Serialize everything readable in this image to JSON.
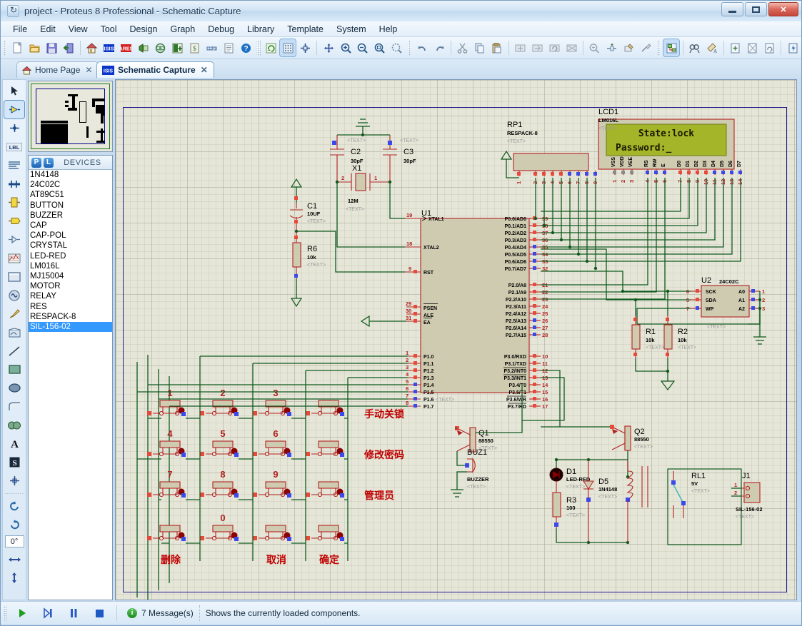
{
  "window": {
    "title": "project - Proteus 8 Professional - Schematic Capture",
    "minimize_label": "",
    "maximize_label": "",
    "close_label": "✕"
  },
  "menubar": {
    "items": [
      "File",
      "Edit",
      "View",
      "Tool",
      "Design",
      "Graph",
      "Debug",
      "Library",
      "Template",
      "System",
      "Help"
    ]
  },
  "tabs": [
    {
      "label": "Home Page",
      "icon": "home-icon",
      "close": "✕",
      "active": false
    },
    {
      "label": "Schematic Capture",
      "icon": "isis-icon",
      "close": "✕",
      "active": true
    }
  ],
  "toolbar": {
    "groups": [
      {
        "buttons": [
          {
            "name": "new-design-button",
            "tip": "New Project"
          },
          {
            "name": "open-design-button",
            "tip": "Open Project"
          },
          {
            "name": "save-design-button",
            "tip": "Save Project"
          },
          {
            "name": "import-export-button",
            "tip": "Import/Export"
          },
          {
            "name": "home-page-button",
            "tip": "Home Page"
          },
          {
            "name": "schematic-capture-button",
            "tip": "Schematic Capture"
          },
          {
            "name": "pcb-layout-button",
            "tip": "PCB Layout"
          },
          {
            "name": "source-code-button",
            "tip": "Source Code"
          },
          {
            "name": "3d-visualizer-button",
            "tip": "3D Visualizer"
          },
          {
            "name": "bill-of-materials-button",
            "tip": "Bill of Materials"
          },
          {
            "name": "design-explorer-button",
            "tip": "Design Explorer"
          },
          {
            "name": "project-clips-button",
            "tip": "Project Clips"
          },
          {
            "name": "report-button",
            "tip": "Report"
          },
          {
            "name": "help-button",
            "tip": "Help"
          }
        ]
      },
      {
        "buttons": [
          {
            "name": "refresh-button",
            "tip": "Redraw"
          },
          {
            "name": "toggle-grid-button",
            "tip": "Toggle Grid"
          },
          {
            "name": "origin-button",
            "tip": "Set Origin"
          },
          {
            "name": "pan-button",
            "tip": "Pan"
          },
          {
            "name": "zoom-in-button",
            "tip": "Zoom In"
          },
          {
            "name": "zoom-out-button",
            "tip": "Zoom Out"
          },
          {
            "name": "zoom-all-button",
            "tip": "Zoom to View Entire Sheet"
          },
          {
            "name": "zoom-area-button",
            "tip": "Zoom to Area"
          }
        ]
      },
      {
        "buttons": [
          {
            "name": "undo-button",
            "tip": "Undo"
          },
          {
            "name": "redo-button",
            "tip": "Redo"
          },
          {
            "name": "cut-button",
            "tip": "Cut to Clipboard"
          },
          {
            "name": "copy-button",
            "tip": "Copy to Clipboard"
          },
          {
            "name": "paste-button",
            "tip": "Paste from Clipboard"
          },
          {
            "name": "block-copy-button",
            "tip": "Block Copy"
          },
          {
            "name": "block-move-button",
            "tip": "Block Move"
          },
          {
            "name": "block-rotate-button",
            "tip": "Block Rotate"
          },
          {
            "name": "block-delete-button",
            "tip": "Block Delete"
          },
          {
            "name": "pick-device-button",
            "tip": "Pick Device"
          },
          {
            "name": "make-device-button",
            "tip": "Make Device"
          },
          {
            "name": "packaging-tool-button",
            "tip": "Packaging Tool"
          },
          {
            "name": "decompose-button",
            "tip": "Decompose"
          }
        ]
      },
      {
        "buttons": [
          {
            "name": "wire-autorouter-button",
            "tip": "Wire Auto-Router",
            "pressed": true
          },
          {
            "name": "search-tag-button",
            "tip": "Search and Tag"
          },
          {
            "name": "property-assignment-button",
            "tip": "Property Assignment Tool"
          },
          {
            "name": "new-sheet-button",
            "tip": "New Sheet"
          },
          {
            "name": "remove-sheet-button",
            "tip": "Remove/Delete Sheet"
          },
          {
            "name": "exit-sheet-button",
            "tip": "Exit to parent sheet"
          },
          {
            "name": "bill-materials-button",
            "tip": "Bill of Materials"
          }
        ]
      }
    ]
  },
  "left_tools": [
    {
      "name": "selection-mode-tool",
      "icon": "arrow-icon",
      "active": false
    },
    {
      "name": "component-mode-tool",
      "icon": "component-icon",
      "active": true
    },
    {
      "name": "junction-dot-tool",
      "icon": "junction-icon",
      "active": false
    },
    {
      "name": "wire-label-tool",
      "icon": "label-icon",
      "active": false
    },
    {
      "name": "text-script-tool",
      "icon": "script-icon",
      "active": false
    },
    {
      "name": "buses-tool",
      "icon": "bus-icon",
      "active": false
    },
    {
      "name": "subcircuit-tool",
      "icon": "subcircuit-icon",
      "active": false
    },
    {
      "name": "terminals-tool",
      "icon": "terminal-icon",
      "active": false
    },
    {
      "name": "device-pins-tool",
      "icon": "devicepin-icon",
      "active": false
    },
    {
      "name": "graph-tool",
      "icon": "graph-icon",
      "active": false
    },
    {
      "name": "tape-recorder-tool",
      "icon": "tape-icon",
      "active": false
    },
    {
      "name": "generator-tool",
      "icon": "generator-icon",
      "active": false
    },
    {
      "name": "voltage-probe-tool",
      "icon": "probe-icon",
      "active": false
    },
    {
      "name": "virtual-instrument-tool",
      "icon": "instrument-icon",
      "active": false
    },
    {
      "name": "line-tool",
      "icon": "line-icon",
      "active": false
    },
    {
      "name": "box-tool",
      "icon": "box-icon",
      "active": false
    },
    {
      "name": "circle-tool",
      "icon": "circle-icon",
      "active": false
    },
    {
      "name": "arc-tool",
      "icon": "arc-icon",
      "active": false
    },
    {
      "name": "path-tool",
      "icon": "path-icon",
      "active": false
    },
    {
      "name": "text-tool",
      "icon": "text-a-icon",
      "active": false
    },
    {
      "name": "symbol-tool",
      "icon": "symbol-s-icon",
      "active": false
    },
    {
      "name": "marker-tool",
      "icon": "marker-icon",
      "active": false
    }
  ],
  "rotation": {
    "clockwise_name": "rotate-clockwise-button",
    "anticlockwise_name": "rotate-anticlockwise-button",
    "angle": "0°",
    "mirror_x_name": "mirror-horizontal-button",
    "mirror_y_name": "mirror-vertical-button"
  },
  "devices_panel": {
    "pick_button": "P",
    "library_button": "L",
    "header": "DEVICES",
    "items": [
      "1N4148",
      "24C02C",
      "AT89C51",
      "BUTTON",
      "BUZZER",
      "CAP",
      "CAP-POL",
      "CRYSTAL",
      "LED-RED",
      "LM016L",
      "MJ15004",
      "MOTOR",
      "RELAY",
      "RES",
      "RESPACK-8",
      "SIL-156-02"
    ],
    "selected": "SIL-156-02"
  },
  "statusbar": {
    "play_button": "play-simulation-button",
    "step_button": "step-simulation-button",
    "pause_button": "pause-simulation-button",
    "stop_button": "stop-simulation-button",
    "messages": "7 Message(s)",
    "hint": "Shows the currently loaded components."
  },
  "schematic": {
    "lcd": {
      "ref": "LCD1",
      "value": "LM016L",
      "text": "<TEXT>",
      "line1": "State:lock",
      "line2": "Password:_",
      "pins": [
        "VSS",
        "VDD",
        "VEE",
        "RS",
        "RW",
        "E",
        "D0",
        "D1",
        "D2",
        "D3",
        "D4",
        "D5",
        "D6",
        "D7"
      ],
      "pin_numbers": [
        "1",
        "2",
        "3",
        "4",
        "5",
        "6",
        "7",
        "8",
        "9",
        "10",
        "11",
        "12",
        "13",
        "14"
      ]
    },
    "u1": {
      "ref": "U1",
      "text": "<TEXT>",
      "left_pins": [
        {
          "num": "19",
          "label": "XTAL1"
        },
        {
          "num": "18",
          "label": "XTAL2"
        },
        {
          "num": "9",
          "label": "RST"
        },
        {
          "num": "29",
          "label": "PSEN"
        },
        {
          "num": "30",
          "label": "ALE"
        },
        {
          "num": "31",
          "label": "EA"
        },
        {
          "num": "1",
          "label": "P1.0"
        },
        {
          "num": "2",
          "label": "P1.1"
        },
        {
          "num": "3",
          "label": "P1.2"
        },
        {
          "num": "4",
          "label": "P1.3"
        },
        {
          "num": "5",
          "label": "P1.4"
        },
        {
          "num": "6",
          "label": "P1.5"
        },
        {
          "num": "7",
          "label": "P1.6"
        },
        {
          "num": "8",
          "label": "P1.7"
        }
      ],
      "right_pins": [
        {
          "num": "39",
          "label": "P0.0/AD0"
        },
        {
          "num": "38",
          "label": "P0.1/AD1"
        },
        {
          "num": "37",
          "label": "P0.2/AD2"
        },
        {
          "num": "36",
          "label": "P0.3/AD3"
        },
        {
          "num": "35",
          "label": "P0.4/AD4"
        },
        {
          "num": "34",
          "label": "P0.5/AD5"
        },
        {
          "num": "33",
          "label": "P0.6/AD6"
        },
        {
          "num": "32",
          "label": "P0.7/AD7"
        },
        {
          "num": "21",
          "label": "P2.0/A8"
        },
        {
          "num": "22",
          "label": "P2.1/A9"
        },
        {
          "num": "23",
          "label": "P2.2/A10"
        },
        {
          "num": "24",
          "label": "P2.3/A11"
        },
        {
          "num": "25",
          "label": "P2.4/A12"
        },
        {
          "num": "26",
          "label": "P2.5/A13"
        },
        {
          "num": "27",
          "label": "P2.6/A14"
        },
        {
          "num": "28",
          "label": "P2.7/A15"
        },
        {
          "num": "10",
          "label": "P3.0/RXD"
        },
        {
          "num": "11",
          "label": "P3.1/TXD"
        },
        {
          "num": "12",
          "label": "P3.2/INT0"
        },
        {
          "num": "13",
          "label": "P3.3/INT1"
        },
        {
          "num": "14",
          "label": "P3.4/T0"
        },
        {
          "num": "15",
          "label": "P3.5/T1"
        },
        {
          "num": "16",
          "label": "P3.6/WR"
        },
        {
          "num": "17",
          "label": "P3.7/RD"
        }
      ]
    },
    "u2": {
      "ref": "U2",
      "value": "24C02C",
      "text": "<TEXT>",
      "left_pins": [
        {
          "num": "6",
          "label": "SCK"
        },
        {
          "num": "5",
          "label": "SDA"
        },
        {
          "num": "7",
          "label": "WP"
        }
      ],
      "right_pins": [
        {
          "num": "1",
          "label": "A0"
        },
        {
          "num": "2",
          "label": "A1"
        },
        {
          "num": "3",
          "label": "A2"
        }
      ]
    },
    "rp1": {
      "ref": "RP1",
      "value": "RESPACK-8",
      "text": "<TEXT>",
      "pins": [
        "1",
        "2",
        "3",
        "4",
        "5",
        "6",
        "7",
        "8",
        "9"
      ]
    },
    "components": [
      {
        "ref": "C1",
        "value": "10UF",
        "text": "<TEXT>"
      },
      {
        "ref": "C2",
        "value": "30pF",
        "text": "<TEXT>"
      },
      {
        "ref": "C3",
        "value": "30pF",
        "text": "<TEXT>"
      },
      {
        "ref": "X1",
        "value": "12M",
        "text": "<TEXT>"
      },
      {
        "ref": "R6",
        "value": "10k",
        "text": "<TEXT>"
      },
      {
        "ref": "R1",
        "value": "10k",
        "text": "<TEXT>"
      },
      {
        "ref": "R2",
        "value": "10k",
        "text": "<TEXT>"
      },
      {
        "ref": "R3",
        "value": "100",
        "text": "<TEXT>"
      },
      {
        "ref": "Q1",
        "value": "88550",
        "text": "<TEXT>"
      },
      {
        "ref": "Q2",
        "value": "88550",
        "text": "<TEXT>"
      },
      {
        "ref": "D1",
        "value": "LED-RED",
        "text": "<TEXT>"
      },
      {
        "ref": "D5",
        "value": "1N4148",
        "text": "<TEXT>"
      },
      {
        "ref": "BUZ1",
        "value": "BUZZER",
        "text": "<TEXT>"
      },
      {
        "ref": "RL1",
        "value": "5V",
        "text": "<TEXT>"
      },
      {
        "ref": "J1",
        "value": "SIL-156-02",
        "text": "<TEXT>"
      }
    ],
    "keypad": {
      "rows": [
        [
          "1",
          "2",
          "3",
          "手动关锁"
        ],
        [
          "4",
          "5",
          "6",
          "修改密码"
        ],
        [
          "7",
          "8",
          "9",
          "管理员"
        ],
        [
          "",
          "0",
          "",
          ""
        ]
      ],
      "bottom_labels": [
        "删除",
        "取消",
        "确定"
      ]
    },
    "j1_pin_numbers": [
      "1",
      "2"
    ],
    "x1_pin_numbers": [
      "2",
      "1"
    ]
  },
  "colors": {
    "schematic_bg": "#e6e6d8",
    "wire_green": "#0f5a1e",
    "body_fill": "#cfcbb0",
    "body_stroke": "#b22222",
    "pin_red": "#e8493a",
    "pin_blue": "#3a49e8",
    "lcd_screen": "#a5b52a",
    "chinese_label": "#c00000",
    "sheet_border": "#1b1b8f",
    "selection_blue": "#3399ff"
  }
}
